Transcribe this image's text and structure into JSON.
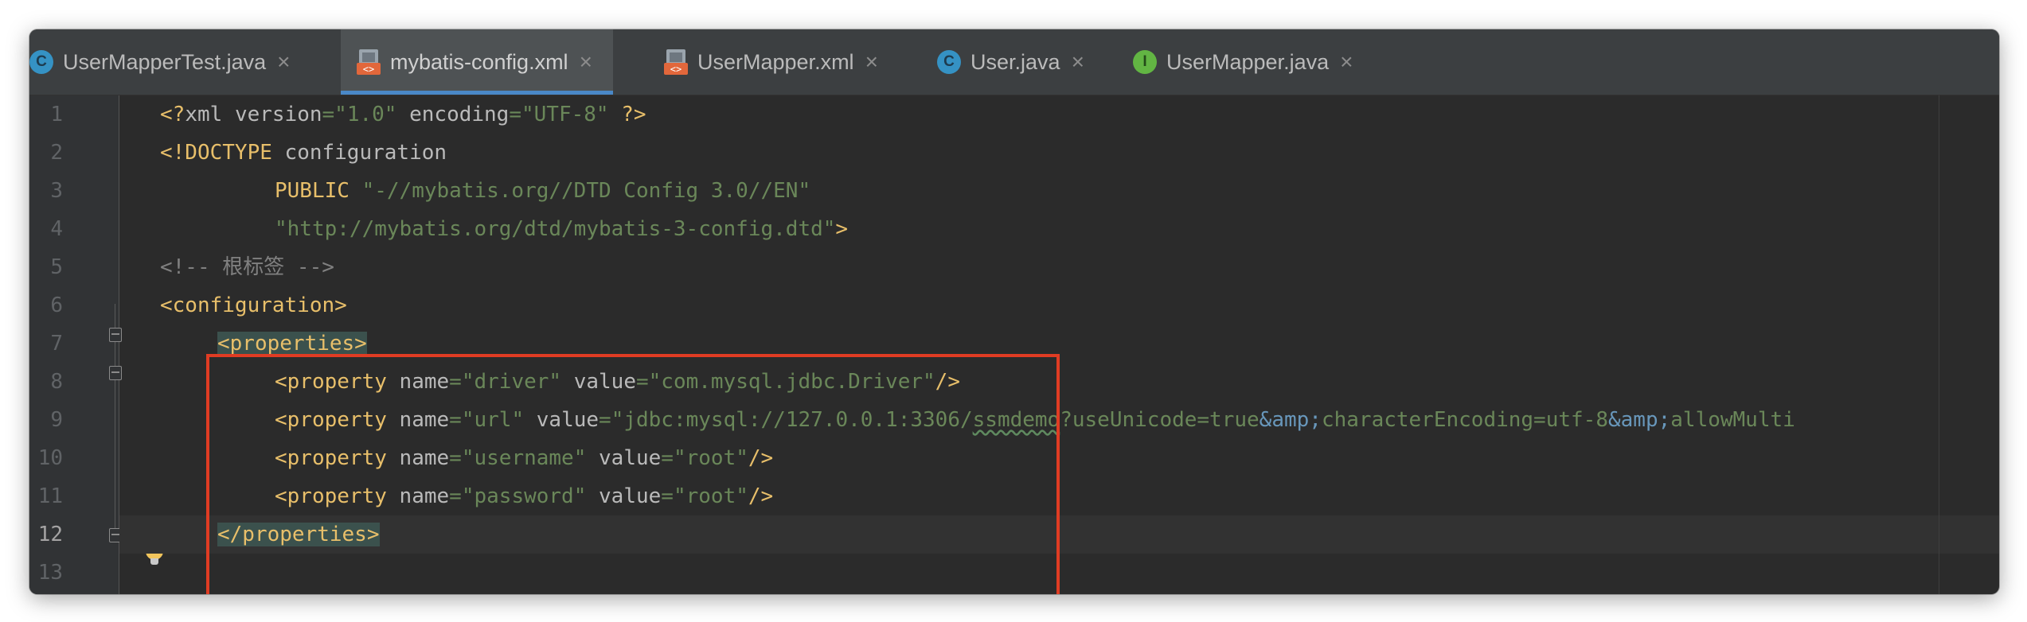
{
  "tabs": [
    {
      "label": "UserMapperTest.java",
      "icon": "java-class-test-icon",
      "active": false
    },
    {
      "label": "mybatis-config.xml",
      "icon": "xml-file-icon",
      "active": true
    },
    {
      "label": "UserMapper.xml",
      "icon": "xml-file-icon",
      "active": false
    },
    {
      "label": "User.java",
      "icon": "java-class-icon",
      "active": false
    },
    {
      "label": "UserMapper.java",
      "icon": "java-interface-icon",
      "active": false
    }
  ],
  "gutter": {
    "line_numbers": [
      "1",
      "2",
      "3",
      "4",
      "5",
      "6",
      "7",
      "8",
      "9",
      "10",
      "11",
      "12",
      "13"
    ],
    "current_line": "12"
  },
  "code": {
    "l1": {
      "a": "<?",
      "b": "xml ",
      "c": "version",
      "d": "=",
      "e": "\"1.0\"",
      "f": " encoding",
      "g": "=",
      "h": "\"UTF-8\"",
      "i": " ?>"
    },
    "l2": {
      "a": "<!DOCTYPE",
      "b": " configuration"
    },
    "l3": {
      "a": "PUBLIC",
      "b": " \"-//mybatis.org//DTD Config 3.0//EN\""
    },
    "l4": {
      "a": "\"http://mybatis.org/dtd/mybatis-3-config.dtd\"",
      "b": ">"
    },
    "l5": {
      "a": "<!-- 根标签 -->"
    },
    "l6": {
      "a": "<configuration>"
    },
    "l7": {
      "a": "<properties>"
    },
    "l8": {
      "a": "<property",
      "b": " name",
      "c": "=",
      "d": "\"driver\"",
      "e": " value",
      "f": "=",
      "g": "\"com.mysql.jdbc.Driver\"",
      "h": "/>"
    },
    "l9": {
      "a": "<property",
      "b": " name",
      "c": "=",
      "d": "\"url\"",
      "e": " value",
      "f": "=",
      "g": "\"jdbc:mysql://127.0.0.1:3306/",
      "h": "ssmdemo",
      "i": "?useUnicode=true",
      "j": "&amp;",
      "k": "characterEncoding=utf-8",
      "l": "&amp;",
      "m": "allowMulti"
    },
    "l10": {
      "a": "<property",
      "b": " name",
      "c": "=",
      "d": "\"username\"",
      "e": " value",
      "f": "=",
      "g": "\"root\"",
      "h": "/>"
    },
    "l11": {
      "a": "<property",
      "b": " name",
      "c": "=",
      "d": "\"password\"",
      "e": " value",
      "f": "=",
      "g": "\"root\"",
      "h": "/>"
    },
    "l12": {
      "a": "</properties>"
    }
  },
  "colors": {
    "tag": "#e8bf6a",
    "attribute": "#bababa",
    "string": "#6a8759",
    "entity": "#6897bb",
    "comment": "#808080",
    "highlight_box": "#e03c23"
  }
}
